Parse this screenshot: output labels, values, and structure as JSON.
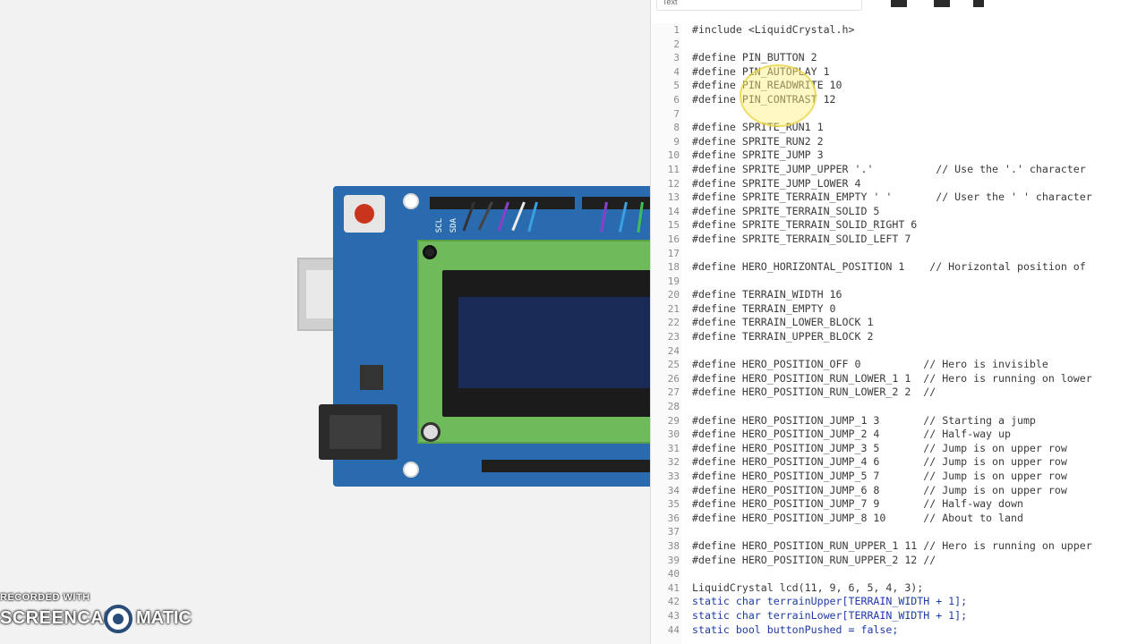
{
  "watermark": {
    "line1": "RECORDED WITH",
    "line2": "SCREENCAST",
    "line3": "MATIC"
  },
  "editor": {
    "mode": "Text",
    "code_lines": [
      {
        "n": "1",
        "t": "#include <LiquidCrystal.h>"
      },
      {
        "n": "2",
        "t": ""
      },
      {
        "n": "3",
        "t": "#define PIN_BUTTON 2"
      },
      {
        "n": "4",
        "t": "#define PIN_AUTOPLAY 1"
      },
      {
        "n": "5",
        "t": "#define PIN_READWRITE 10"
      },
      {
        "n": "6",
        "t": "#define PIN_CONTRAST 12"
      },
      {
        "n": "7",
        "t": ""
      },
      {
        "n": "8",
        "t": "#define SPRITE_RUN1 1"
      },
      {
        "n": "9",
        "t": "#define SPRITE_RUN2 2"
      },
      {
        "n": "10",
        "t": "#define SPRITE_JUMP 3"
      },
      {
        "n": "11",
        "t": "#define SPRITE_JUMP_UPPER '.'          // Use the '.' character"
      },
      {
        "n": "12",
        "t": "#define SPRITE_JUMP_LOWER 4"
      },
      {
        "n": "13",
        "t": "#define SPRITE_TERRAIN_EMPTY ' '       // User the ' ' character"
      },
      {
        "n": "14",
        "t": "#define SPRITE_TERRAIN_SOLID 5"
      },
      {
        "n": "15",
        "t": "#define SPRITE_TERRAIN_SOLID_RIGHT 6"
      },
      {
        "n": "16",
        "t": "#define SPRITE_TERRAIN_SOLID_LEFT 7"
      },
      {
        "n": "17",
        "t": ""
      },
      {
        "n": "18",
        "t": "#define HERO_HORIZONTAL_POSITION 1    // Horizontal position of"
      },
      {
        "n": "19",
        "t": ""
      },
      {
        "n": "20",
        "t": "#define TERRAIN_WIDTH 16"
      },
      {
        "n": "21",
        "t": "#define TERRAIN_EMPTY 0"
      },
      {
        "n": "22",
        "t": "#define TERRAIN_LOWER_BLOCK 1"
      },
      {
        "n": "23",
        "t": "#define TERRAIN_UPPER_BLOCK 2"
      },
      {
        "n": "24",
        "t": ""
      },
      {
        "n": "25",
        "t": "#define HERO_POSITION_OFF 0          // Hero is invisible"
      },
      {
        "n": "26",
        "t": "#define HERO_POSITION_RUN_LOWER_1 1  // Hero is running on lower"
      },
      {
        "n": "27",
        "t": "#define HERO_POSITION_RUN_LOWER_2 2  //"
      },
      {
        "n": "28",
        "t": ""
      },
      {
        "n": "29",
        "t": "#define HERO_POSITION_JUMP_1 3       // Starting a jump"
      },
      {
        "n": "30",
        "t": "#define HERO_POSITION_JUMP_2 4       // Half-way up"
      },
      {
        "n": "31",
        "t": "#define HERO_POSITION_JUMP_3 5       // Jump is on upper row"
      },
      {
        "n": "32",
        "t": "#define HERO_POSITION_JUMP_4 6       // Jump is on upper row"
      },
      {
        "n": "33",
        "t": "#define HERO_POSITION_JUMP_5 7       // Jump is on upper row"
      },
      {
        "n": "34",
        "t": "#define HERO_POSITION_JUMP_6 8       // Jump is on upper row"
      },
      {
        "n": "35",
        "t": "#define HERO_POSITION_JUMP_7 9       // Half-way down"
      },
      {
        "n": "36",
        "t": "#define HERO_POSITION_JUMP_8 10      // About to land"
      },
      {
        "n": "37",
        "t": ""
      },
      {
        "n": "38",
        "t": "#define HERO_POSITION_RUN_UPPER_1 11 // Hero is running on upper"
      },
      {
        "n": "39",
        "t": "#define HERO_POSITION_RUN_UPPER_2 12 //"
      },
      {
        "n": "40",
        "t": ""
      },
      {
        "n": "41",
        "t": "LiquidCrystal lcd(11, 9, 6, 5, 4, 3);"
      },
      {
        "n": "42",
        "t": "static char terrainUpper[TERRAIN_WIDTH + 1];"
      },
      {
        "n": "43",
        "t": "static char terrainLower[TERRAIN_WIDTH + 1];"
      },
      {
        "n": "44",
        "t": "static bool buttonPushed = false;"
      }
    ]
  },
  "colors": {
    "board": "#2a6bb0",
    "lcd_pcb": "#6fba5a",
    "lcd_screen": "#1a2a56",
    "keyword": "#1e3aa8"
  }
}
